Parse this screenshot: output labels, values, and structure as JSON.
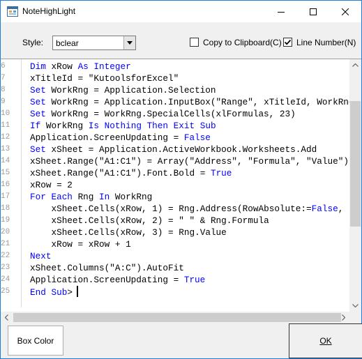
{
  "window": {
    "title": "NoteHighLight"
  },
  "toolbar": {
    "style_label": "Style:",
    "style_value": "bclear",
    "copy_label": "Copy to Clipboard(C)",
    "copy_checked": false,
    "line_number_label": "Line Number(N)",
    "line_number_checked": true
  },
  "editor": {
    "line_numbers": [
      "6",
      "7",
      "8",
      "9",
      "10",
      "11",
      "12",
      "13",
      "14",
      "15",
      "16",
      "17",
      "18",
      "19",
      "20",
      "21",
      "22",
      "23",
      "24",
      "25"
    ],
    "lines": [
      "Dim xRow As Integer",
      "xTitleId = \"KutoolsforExcel\"",
      "Set WorkRng = Application.Selection",
      "Set WorkRng = Application.InputBox(\"Range\", xTitleId, WorkRng.",
      "Set WorkRng = WorkRng.SpecialCells(xlFormulas, 23)",
      "If WorkRng Is Nothing Then Exit Sub",
      "Application.ScreenUpdating = False",
      "Set xSheet = Application.ActiveWorkbook.Worksheets.Add",
      "xSheet.Range(\"A1:C1\") = Array(\"Address\", \"Formula\", \"Value\")",
      "xSheet.Range(\"A1:C1\").Font.Bold = True",
      "xRow = 2",
      "For Each Rng In WorkRng",
      "    xSheet.Cells(xRow, 1) = Rng.Address(RowAbsolute:=False,",
      "    xSheet.Cells(xRow, 2) = \" \" & Rng.Formula",
      "    xSheet.Cells(xRow, 3) = Rng.Value",
      "    xRow = xRow + 1",
      "Next",
      "xSheet.Columns(\"A:C\").AutoFit",
      "Application.ScreenUpdating = True",
      "End Sub>"
    ],
    "keywords": [
      "Dim",
      "As",
      "Integer",
      "Set",
      "If",
      "Is",
      "Nothing",
      "Then",
      "Exit",
      "Sub",
      "For",
      "Each",
      "In",
      "Next",
      "End",
      "False",
      "True"
    ],
    "keyword_color": "#0000ff"
  },
  "footer": {
    "box_color_label": "Box Color",
    "ok_label": "OK"
  },
  "colors": {
    "window_border": "#1e7fd6",
    "line_number_color": "#9a9a9a"
  }
}
